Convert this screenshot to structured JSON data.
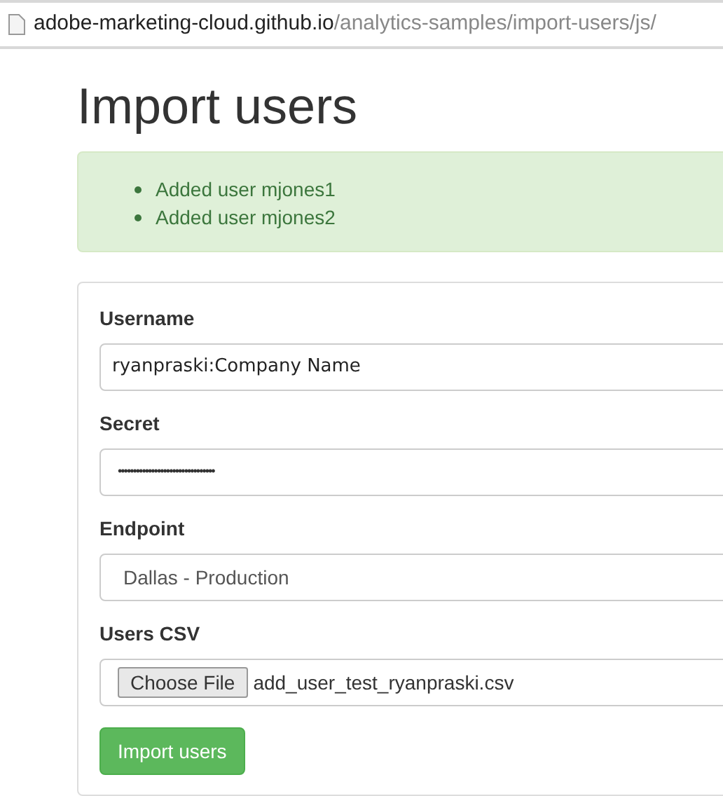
{
  "address_bar": {
    "domain": "adobe-marketing-cloud.github.io",
    "path": "/analytics-samples/import-users/js/"
  },
  "heading": "Import users",
  "alert": {
    "messages": [
      "Added user mjones1",
      "Added user mjones2"
    ]
  },
  "form": {
    "fields": [
      {
        "kind": "text",
        "label": "Username",
        "value": "ryanpraski:Company Name"
      },
      {
        "kind": "password",
        "label": "Secret",
        "value": "••••••••••••••••••••••••••••••••"
      },
      {
        "kind": "select",
        "label": "Endpoint",
        "value": "Dallas - Production"
      },
      {
        "kind": "file",
        "label": "Users CSV",
        "button": "Choose File",
        "value": "add_user_test_ryanpraski.csv"
      }
    ],
    "submit": "Import users"
  }
}
